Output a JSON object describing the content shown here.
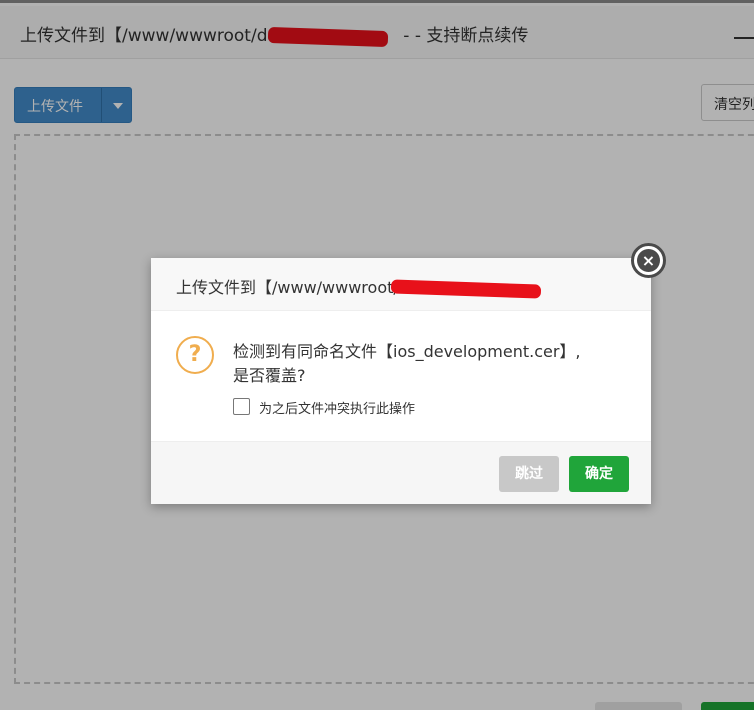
{
  "background_window": {
    "title": "上传文件到【/www/wwwroot/d",
    "title_suffix": "- - 支持断点续传",
    "upload_button_label": "上传文件",
    "clear_button_label": "清空列"
  },
  "dialog": {
    "title": "上传文件到【/www/wwwroot/d",
    "message_line1": "检测到有同命名文件【ios_development.cer】,",
    "message_line2": "是否覆盖?",
    "checkbox_label": "为之后文件冲突执行此操作",
    "skip_button_label": "跳过",
    "confirm_button_label": "确定",
    "close_icon_glyph": "×",
    "question_icon_glyph": "?"
  },
  "colors": {
    "primary": "#428bca",
    "success": "#20a53a",
    "warning_icon": "#f0ad4e",
    "redaction": "#e8111a"
  },
  "icons": [
    "dropdown-caret-icon",
    "close-icon",
    "question-icon",
    "minimize-icon"
  ]
}
